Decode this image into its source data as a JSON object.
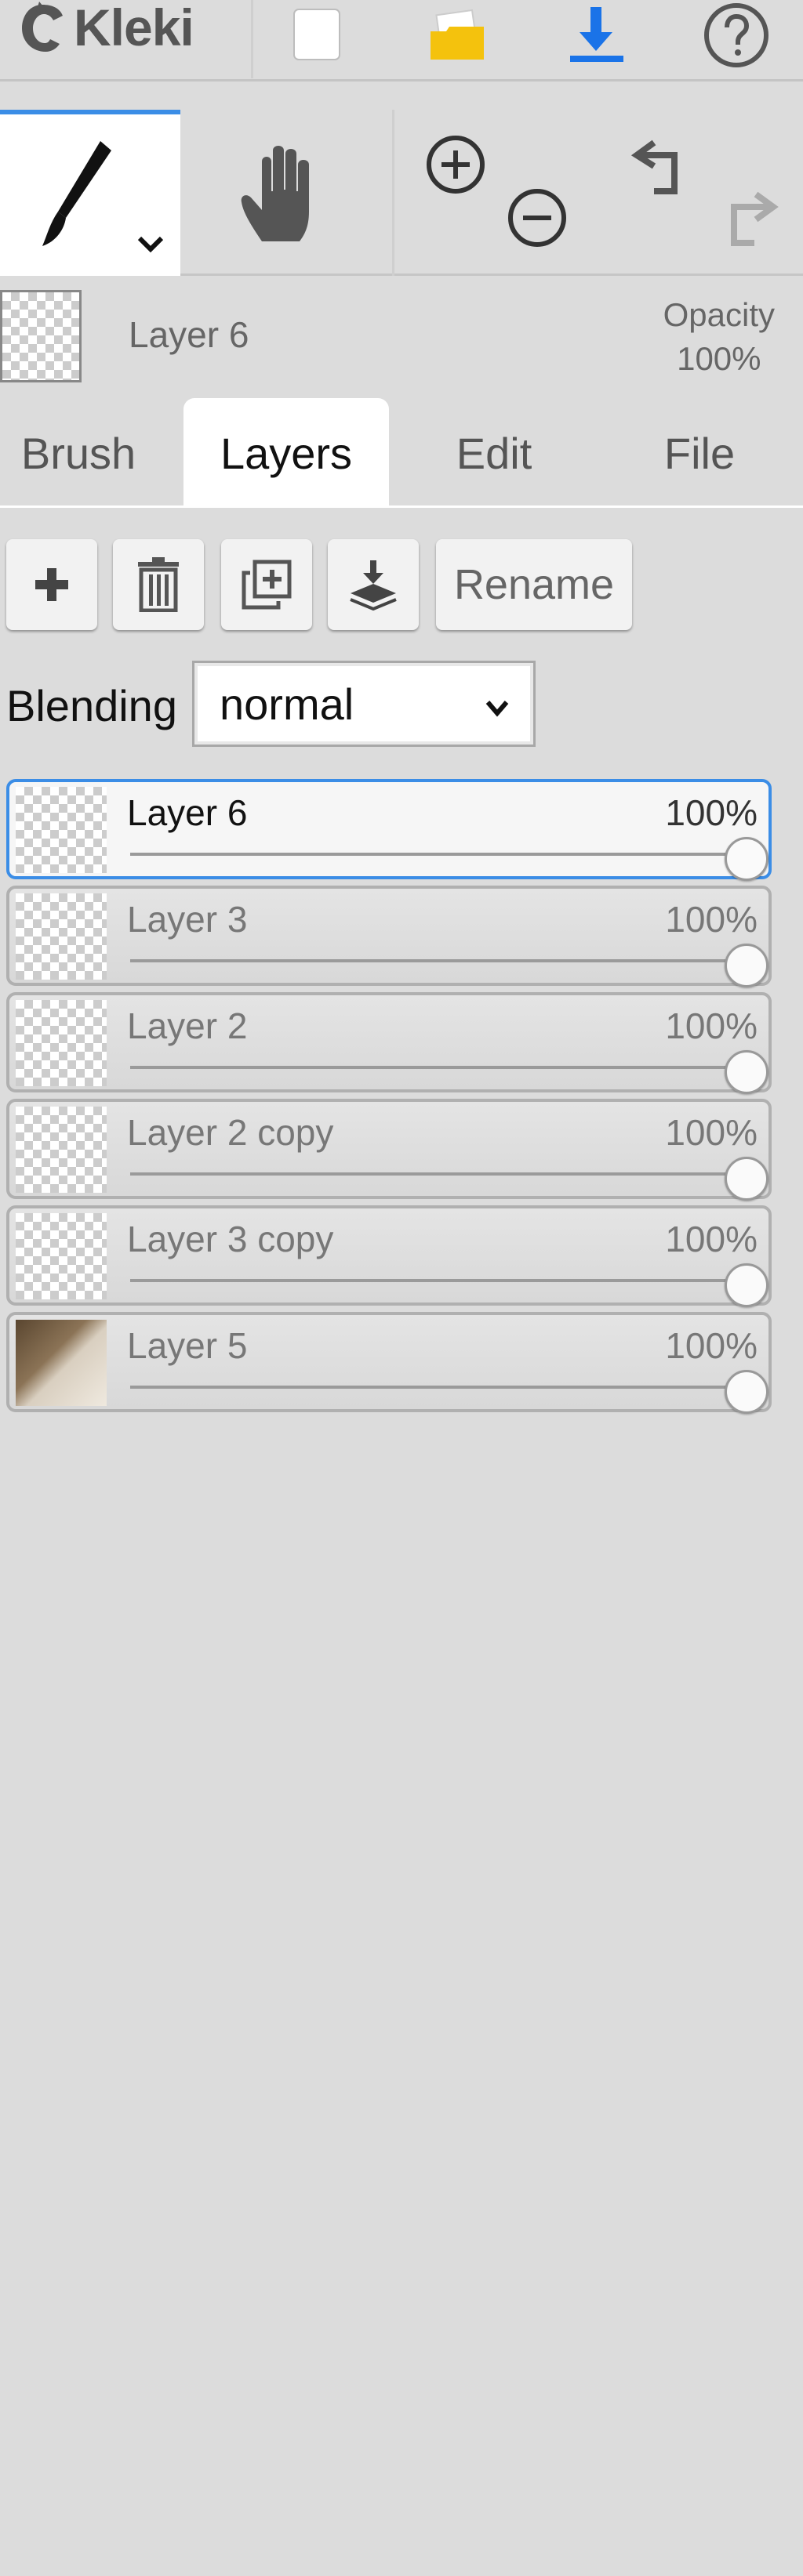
{
  "app": {
    "name": "Kleki"
  },
  "topbar": {
    "icons": [
      "new-document-icon",
      "open-folder-icon",
      "download-icon",
      "help-icon"
    ],
    "accent": "#1a73e8",
    "folder_color": "#f4c20d"
  },
  "tools": {
    "items": [
      "brush-icon",
      "hand-icon",
      "zoom-in-icon",
      "zoom-out-icon",
      "undo-icon",
      "redo-icon"
    ],
    "active": "brush"
  },
  "current_layer": {
    "name": "Layer 6",
    "opacity_label": "Opacity",
    "opacity_value": "100%"
  },
  "tabs": [
    {
      "label": "Brush",
      "active": false
    },
    {
      "label": "Layers",
      "active": true
    },
    {
      "label": "Edit",
      "active": false
    },
    {
      "label": "File",
      "active": false
    }
  ],
  "layer_actions": {
    "add_icon": "plus-icon",
    "delete_icon": "trash-icon",
    "duplicate_icon": "duplicate-icon",
    "merge_icon": "merge-down-icon",
    "rename_label": "Rename"
  },
  "blending": {
    "label": "Blending",
    "value": "normal"
  },
  "layers": [
    {
      "name": "Layer 6",
      "opacity": "100%",
      "level": 1.0,
      "selected": true
    },
    {
      "name": "Layer 3",
      "opacity": "100%",
      "level": 1.0,
      "selected": false
    },
    {
      "name": "Layer 2",
      "opacity": "100%",
      "level": 1.0,
      "selected": false
    },
    {
      "name": "Layer 2 copy",
      "opacity": "100%",
      "level": 1.0,
      "selected": false
    },
    {
      "name": "Layer 3 copy",
      "opacity": "100%",
      "level": 1.0,
      "selected": false
    },
    {
      "name": "Layer 5",
      "opacity": "100%",
      "level": 1.0,
      "selected": false
    }
  ]
}
